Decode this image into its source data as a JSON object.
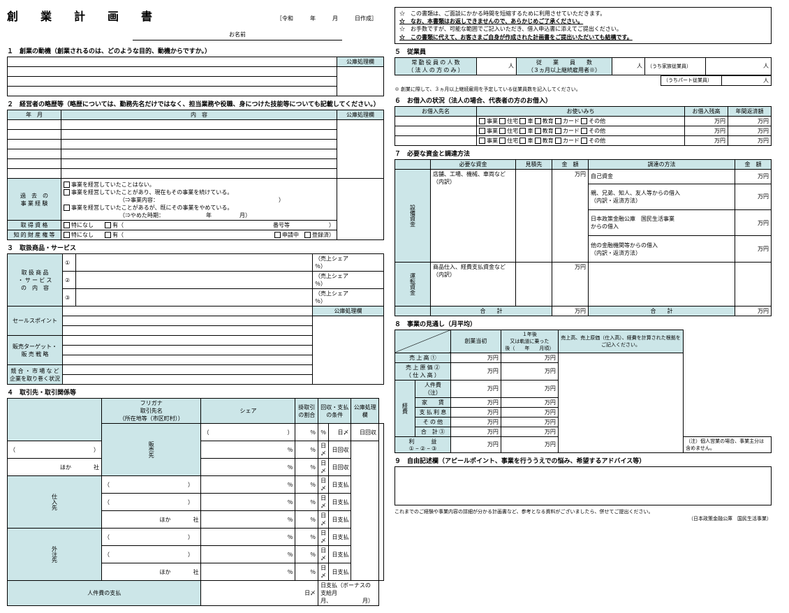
{
  "doc": {
    "title": "創　業　計　画　書",
    "date_prefix": "［令和　　　年　　　月　　　日作成］",
    "name_label": "お名前"
  },
  "s1": {
    "head": "１　創業の動機（創業されるのは、どのような目的、動機からですか。）",
    "kouko": "公庫処理欄"
  },
  "s2": {
    "head": "２　経営者の略歴等（略歴については、勤務先名だけではなく、担当業務や役職、身につけた技能等についても記載してください。）",
    "h1": "年　月",
    "h2": "内　容",
    "h3": "公庫処理欄",
    "past_label": "過　去　の\n事 業 経 験",
    "exp1": "事業を経営していたことはない。",
    "exp2": "事業を経営していたことがあり、現在もその事業を続けている。",
    "exp2b": "（⇒事業内容：　　　　　　　　　　　　　　　　　　　　　　）",
    "exp3": "事業を経営していたことがあるが、既にその事業をやめている。",
    "exp3b": "（⇒やめた時期：　　　　　　　　年　　　　　月）",
    "shikaku": "取 得 資 格",
    "ip": "知 的 財 産 権 等",
    "nashi": "特になし",
    "ari": "有（",
    "num": "番号等",
    "applying": "申請中",
    "registered": "登録済",
    "close": "）"
  },
  "s3": {
    "head": "３　取扱商品・サービス",
    "rowhead": "取 扱 商 品\n・ サ ー ビ ス\nの　内　容",
    "share": "（売上シェア　　　　　％）",
    "n1": "①",
    "n2": "②",
    "n3": "③",
    "kouko": "公庫処理欄",
    "sp": "セールスポイント",
    "tgt": "販売ターゲット・\n販 売 戦 略",
    "comp": "競 合 ・ 市 場 な ど\n企業を取り巻く状況"
  },
  "s4": {
    "head": "４　取引先・取引関係等",
    "furigana": "フリガナ",
    "name": "取引先名",
    "loc": "（所在地等（市区町村））",
    "share": "シェア",
    "kake": "掛取引\nの割合",
    "terms": "回収・支払の条件",
    "kouko": "公庫処理欄",
    "hanbai": "販売先",
    "shire": "仕入先",
    "gaichu": "外注先",
    "hoka": "ほか　　　　社",
    "pct": "％",
    "slash": "日〆",
    "kaishu": "日回収",
    "shiharai": "日支払",
    "jinken": "人件費の支払",
    "bonus": "日支払（ボーナスの支給月　　　　　　　　月、　　　　　　月）"
  },
  "stars": {
    "l1": "☆　この書類は、ご面談にかかる時間を短縮するために利用させていただきます。",
    "l2": "☆　なお、本書類はお返しできませんので、あらかじめご了承ください。",
    "l3": "☆　お手数ですが、可能な範囲でご記入いただき、借入申込書に添えてご提出ください。",
    "l4": "☆　この書類に代えて、お客さまご自身が作成された計画書をご提出いただいても結構です。"
  },
  "s5": {
    "head": "５　従業員",
    "h1": "常 勤 役 員 の 人 数\n（ 法 人 の 方 の み ）",
    "unit": "人",
    "h2": "従　　業　　員　　数\n（３ヵ月以上継続雇用者※）",
    "sub1": "（うち家族従業員）",
    "sub2": "（うちパート従業員）",
    "note": "※ 創業に際して、３ヵ月以上継続雇用を予定している従業員数を記入してください。"
  },
  "s6": {
    "head": "６　お借入の状況（法人の場合、代表者の方のお借入）",
    "h1": "お借入先名",
    "h2": "お使いみち",
    "h3": "お借入残高",
    "h4": "年間返済額",
    "use1": "事業",
    "use2": "住宅",
    "use3": "車",
    "use4": "教育",
    "use5": "カード",
    "use6": "その他",
    "man": "万円"
  },
  "s7": {
    "head": "７　必要な資金と調達方法",
    "h1": "必要な資金",
    "h2": "見積先",
    "h3": "金　額",
    "h4": "調達の方法",
    "h5": "金　額",
    "setsubi": "設備資金",
    "unten": "運転資金",
    "r1": "店舗、工場、機械、車両など\n（内訳）",
    "r2": "商品仕入、経費支払資金など\n（内訳）",
    "c1": "自己資金",
    "c2": "親、兄弟、知人、友人等からの借入\n（内訳・返済方法）",
    "c3": "日本政策金融公庫　国民生活事業\nからの借入",
    "c4": "他の金融機関等からの借入\n（内訳・返済方法）",
    "total": "合　　計",
    "man": "万円"
  },
  "s8": {
    "head": "８　事業の見通し（月平均）",
    "h1": "創業当初",
    "h2": "１年後\n又は軌道に乗った\n後（　　年　　月頃）",
    "h3": "売上高、売上原価（仕入高）、経費を計算された根拠をご記入ください。",
    "r1": "売 上 高 ①",
    "r2": "売 上 原 価 ②\n（ 仕 入 高 ）",
    "r3": "人件費（注）",
    "r4": "家　　賃",
    "r5": "支 払 利 息",
    "r6": "そ  の  他",
    "r7": "合　計 ③",
    "keihi": "経費",
    "r8": "利　　　益\n① − ② − ③",
    "man": "万円",
    "note": "（注）個人営業の場合、事業主分は含めません。"
  },
  "s9": {
    "head": "９　自由記述欄（アピールポイント、事業を行ううえでの悩み、希望するアドバイス等）"
  },
  "footer": {
    "l1": "これまでのご経験や事業内容の詳細が分かる計画書など、参考となる資料がございましたら、併せてご提出ください。",
    "l2": "（日本政策金融公庫　国民生活事業）"
  }
}
